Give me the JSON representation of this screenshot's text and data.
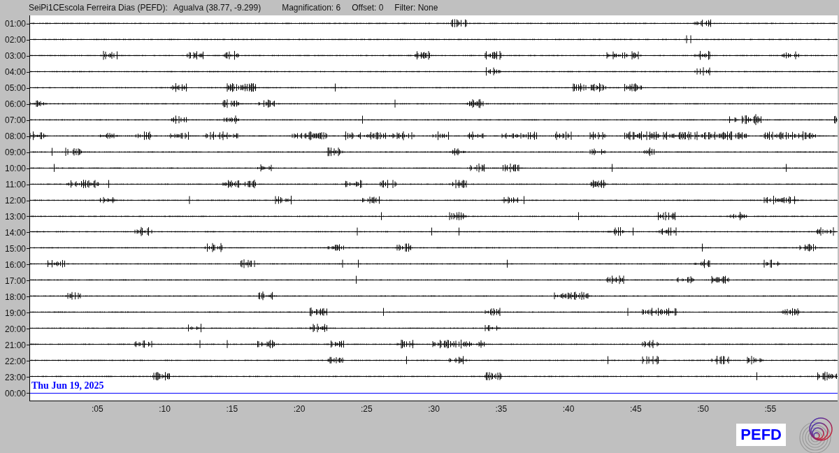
{
  "header": {
    "station": "SeiPi1CEscola Ferreira Dias (PEFD):",
    "location": "Agualva (38.77, -9.299)",
    "magnification": "Magnification: 6",
    "offset": "Offset: 0",
    "filter": "Filter: None"
  },
  "rows": [
    {
      "label": "01:00",
      "current": false
    },
    {
      "label": "02:00",
      "current": false
    },
    {
      "label": "03:00",
      "current": false
    },
    {
      "label": "04:00",
      "current": false
    },
    {
      "label": "05:00",
      "current": false
    },
    {
      "label": "06:00",
      "current": false
    },
    {
      "label": "07:00",
      "current": false
    },
    {
      "label": "08:00",
      "current": false
    },
    {
      "label": "09:00",
      "current": false
    },
    {
      "label": "10:00",
      "current": false
    },
    {
      "label": "11:00",
      "current": false
    },
    {
      "label": "12:00",
      "current": false
    },
    {
      "label": "13:00",
      "current": false
    },
    {
      "label": "14:00",
      "current": false
    },
    {
      "label": "15:00",
      "current": false
    },
    {
      "label": "16:00",
      "current": false
    },
    {
      "label": "17:00",
      "current": false
    },
    {
      "label": "18:00",
      "current": false
    },
    {
      "label": "19:00",
      "current": false
    },
    {
      "label": "20:00",
      "current": false
    },
    {
      "label": "21:00",
      "current": false
    },
    {
      "label": "22:00",
      "current": false
    },
    {
      "label": "23:00",
      "current": false
    },
    {
      "label": "00:00",
      "current": true
    }
  ],
  "date": "Thu Jun 19, 2025",
  "x_ticks": [
    ":05",
    ":10",
    ":15",
    ":20",
    ":25",
    ":30",
    ":35",
    ":40",
    ":45",
    ":50",
    ":55"
  ],
  "logo": "PEFD"
}
